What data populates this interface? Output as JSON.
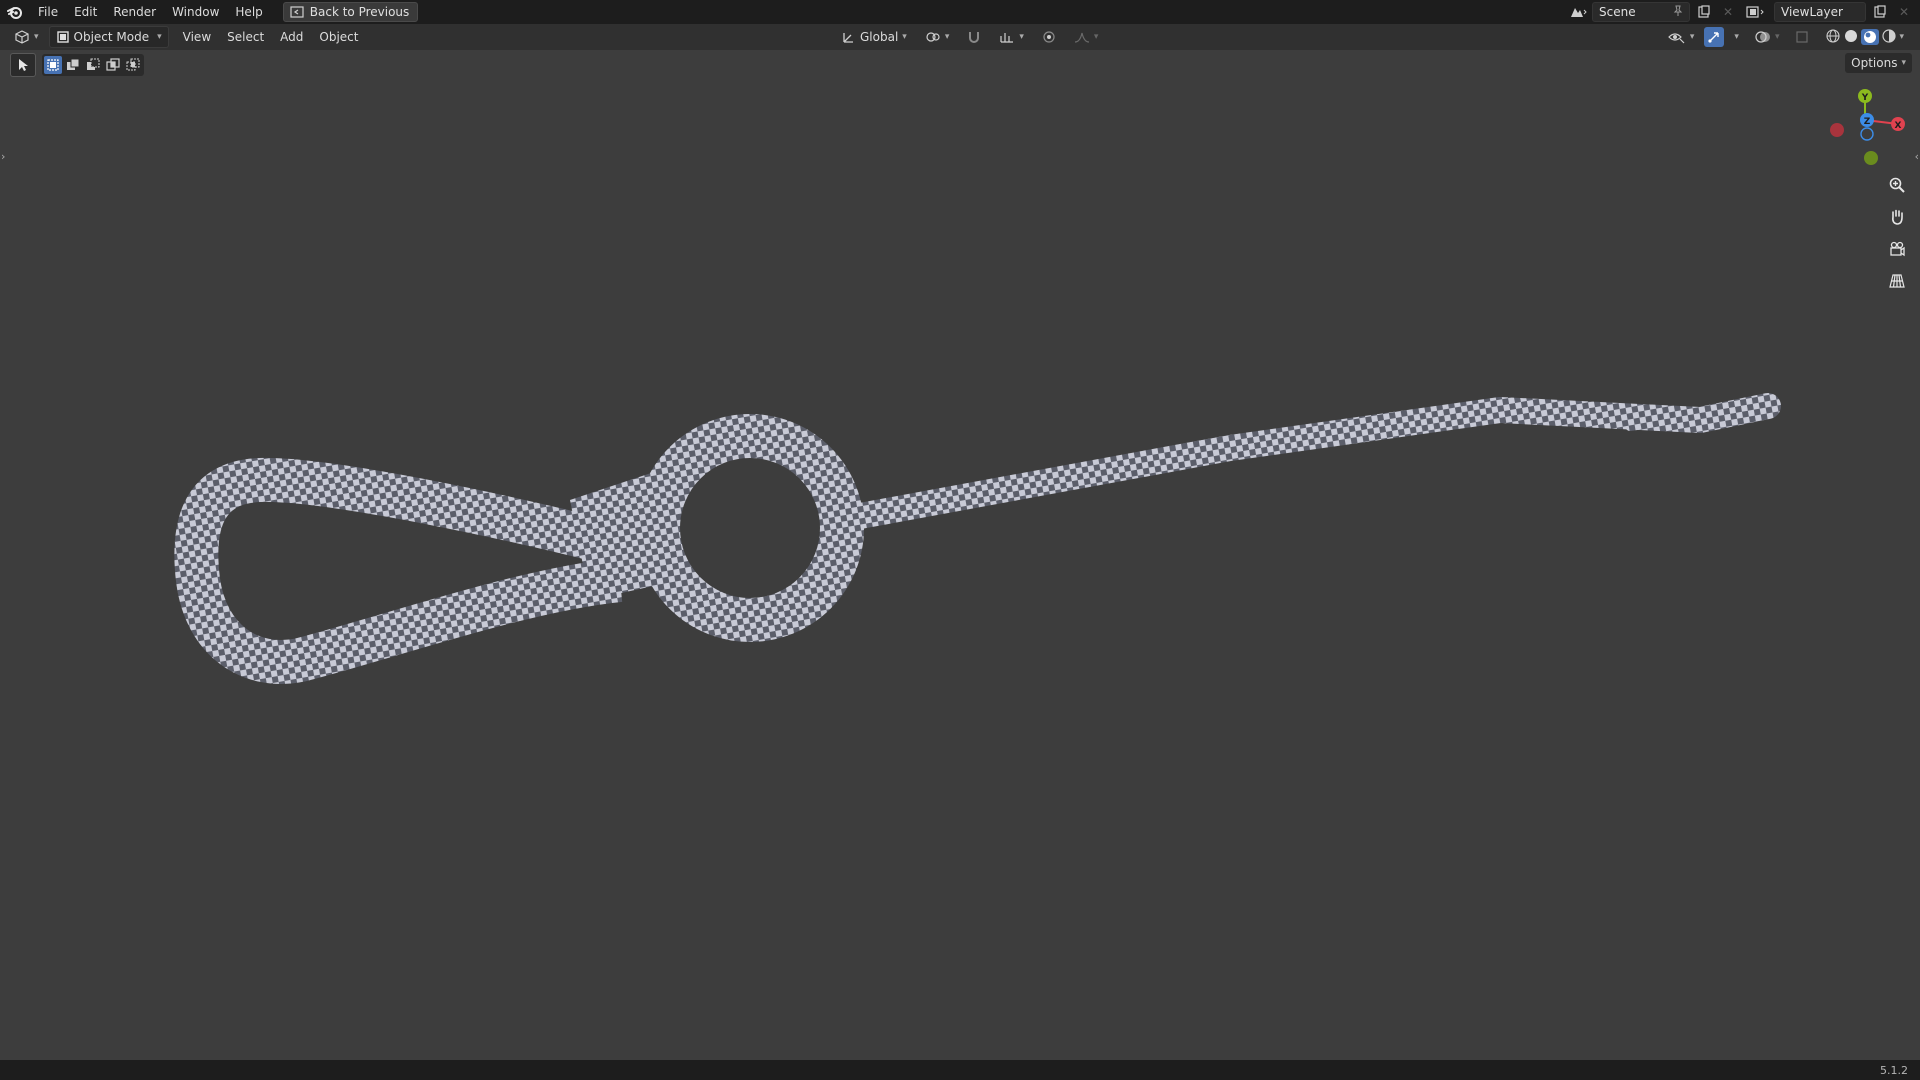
{
  "topbar": {
    "menu": [
      "File",
      "Edit",
      "Render",
      "Window",
      "Help"
    ],
    "back_button": "Back to Previous",
    "scene_name": "Scene",
    "view_layer": "ViewLayer"
  },
  "header": {
    "mode": "Object Mode",
    "menus": [
      "View",
      "Select",
      "Add",
      "Object"
    ],
    "transform_orientation": "Global"
  },
  "toolbar": {
    "options_label": "Options"
  },
  "gizmo": {
    "axis_y": "Y",
    "axis_z": "Z",
    "axis_x": "X",
    "colors": {
      "x": "#e0424f",
      "y": "#8cba1e",
      "z": "#3c8de8"
    }
  },
  "status": {
    "version": "5.1.2"
  },
  "theme": {
    "viewport_bg": "#3d3d3d",
    "accent": "#4772b3"
  }
}
